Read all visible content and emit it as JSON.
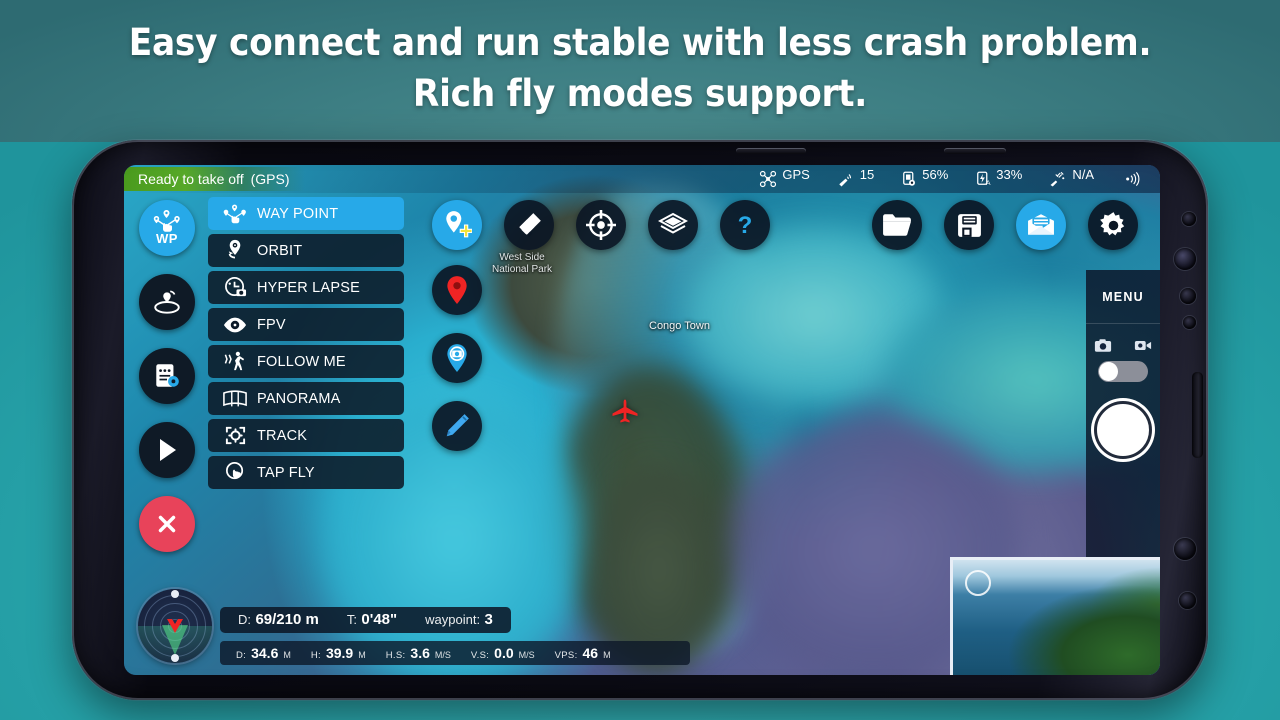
{
  "promo": {
    "line1": "Easy connect and run stable with less crash problem.",
    "line2": "Rich fly modes support."
  },
  "status_bar": {
    "ready_text": "Ready to take off",
    "ready_mode": "(GPS)",
    "gps_label": "GPS",
    "satellites": "15",
    "remote_battery": "56%",
    "aircraft_battery": "33%",
    "signal_value": "N/A"
  },
  "left_rail": {
    "active_label": "WP",
    "buttons": [
      {
        "name": "waypoint-mode",
        "icon": "waypoint-network-icon"
      },
      {
        "name": "orbit-radius",
        "icon": "orbit-ring-icon"
      },
      {
        "name": "mission-settings",
        "icon": "document-gear-icon"
      },
      {
        "name": "play-mission",
        "icon": "play-icon"
      },
      {
        "name": "cancel-mission",
        "icon": "close-icon"
      }
    ]
  },
  "flight_modes": {
    "selected": "WAY POINT",
    "items": [
      {
        "label": "WAY POINT",
        "icon": "waypoint-network-icon"
      },
      {
        "label": "ORBIT",
        "icon": "orbit-pin-icon"
      },
      {
        "label": "HYPER LAPSE",
        "icon": "clock-camera-icon"
      },
      {
        "label": "FPV",
        "icon": "eye-icon"
      },
      {
        "label": "FOLLOW ME",
        "icon": "walking-person-icon"
      },
      {
        "label": "PANORAMA",
        "icon": "panorama-icon"
      },
      {
        "label": "TRACK",
        "icon": "track-target-icon"
      },
      {
        "label": "TAP FLY",
        "icon": "tap-finger-icon"
      }
    ]
  },
  "center_toolbar": [
    {
      "name": "add-waypoint-button",
      "icon": "map-pin-plus-icon",
      "accent": true
    },
    {
      "name": "erase-button",
      "icon": "eraser-icon",
      "accent": false
    },
    {
      "name": "center-map-button",
      "icon": "crosshair-icon",
      "accent": false
    },
    {
      "name": "map-layers-button",
      "icon": "layers-icon",
      "accent": false
    },
    {
      "name": "help-button",
      "icon": "question-mark-icon",
      "accent": false
    }
  ],
  "center_column": [
    {
      "name": "home-point-button",
      "icon": "red-pin-icon"
    },
    {
      "name": "photo-waypoint-button",
      "icon": "camera-pin-icon"
    },
    {
      "name": "edit-route-button",
      "icon": "pencil-icon"
    }
  ],
  "right_toolbar": [
    {
      "name": "open-mission-button",
      "icon": "folder-icon",
      "accent": false
    },
    {
      "name": "save-mission-button",
      "icon": "floppy-disk-icon",
      "accent": false
    },
    {
      "name": "upload-mission-button",
      "icon": "envelope-icon",
      "accent": true
    },
    {
      "name": "settings-button",
      "icon": "gear-icon",
      "accent": false
    }
  ],
  "right_panel": {
    "menu_label": "MENU",
    "photo_icon": "photo-camera-icon",
    "video_icon": "video-camera-icon",
    "toggle_state": "photo",
    "shutter_name": "shutter-button",
    "sliders_icon": "sliders-icon"
  },
  "telemetry": {
    "main": [
      {
        "key": "D:",
        "value": "69/210 m"
      },
      {
        "key": "T:",
        "value": "0'48\""
      },
      {
        "key": "waypoint:",
        "value": "3"
      }
    ],
    "sub": [
      {
        "key": "D:",
        "value": "34.6",
        "unit": "M"
      },
      {
        "key": "H:",
        "value": "39.9",
        "unit": "M"
      },
      {
        "key": "H.S:",
        "value": "3.6",
        "unit": "M/S"
      },
      {
        "key": "V.S:",
        "value": "0.0",
        "unit": "M/S"
      },
      {
        "key": "VPS:",
        "value": "46",
        "unit": "M"
      }
    ]
  },
  "map": {
    "labels": {
      "town": "Congo Town",
      "park_line1": "West Side",
      "park_line2": "National Park"
    },
    "aircraft_marker": "aircraft-icon"
  },
  "colors": {
    "accent": "#27a9e8",
    "danger": "#e8435a",
    "ready_green": "#57a828",
    "panel_dark": "#0c1a28"
  }
}
